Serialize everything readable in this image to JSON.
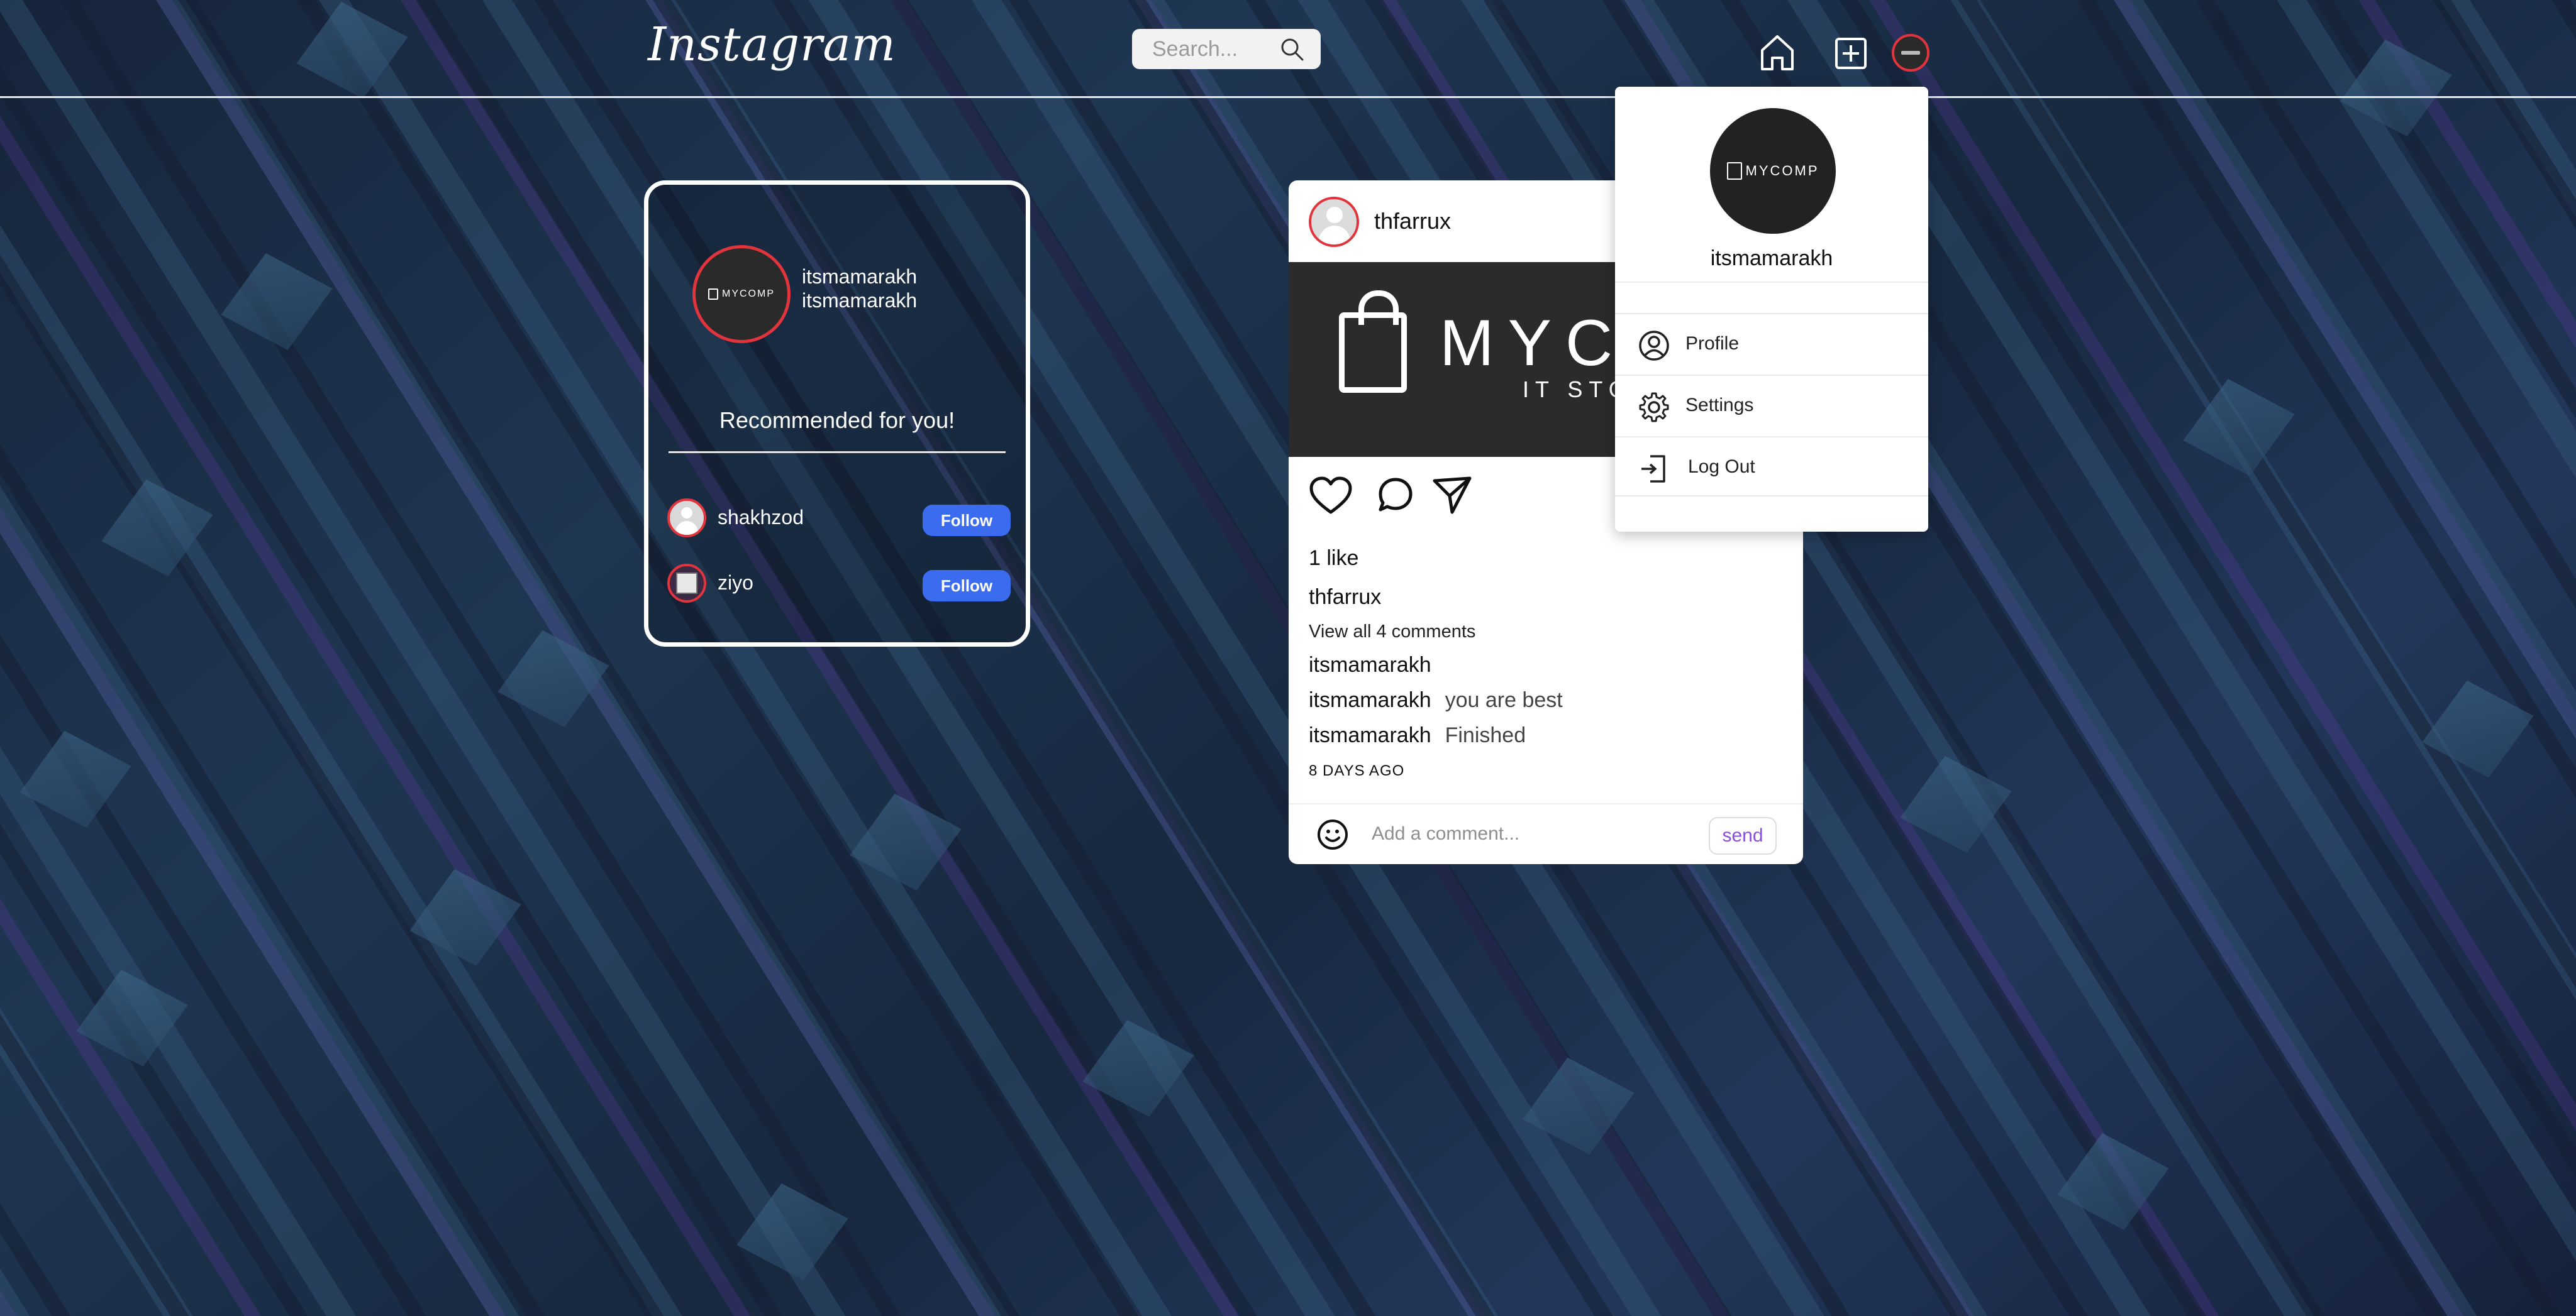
{
  "header": {
    "logo": "Instagram",
    "search_placeholder": "Search..."
  },
  "sidebar_card": {
    "username": "itsmamarakh",
    "display_name": "itsmamarakh",
    "recommended_title": "Recommended for you!",
    "suggestions": [
      {
        "username": "shakhzod",
        "button": "Follow"
      },
      {
        "username": "ziyo",
        "button": "Follow"
      }
    ]
  },
  "post": {
    "author": "thfarrux",
    "image_brand": "MYCOMP",
    "image_tagline": "IT STORE",
    "likes_text": "1 like",
    "caption_user": "thfarrux",
    "view_all_comments": "View all 4 comments",
    "comments": [
      {
        "user": "itsmamarakh",
        "text": ""
      },
      {
        "user": "itsmamarakh",
        "text": "you are best"
      },
      {
        "user": "itsmamarakh",
        "text": "Finished"
      }
    ],
    "time_ago": "8 DAYS AGO",
    "comment_placeholder": "Add a comment...",
    "send_label": "send"
  },
  "dropdown": {
    "avatar_brand": "MYCOMP",
    "username": "itsmamarakh",
    "items": [
      {
        "label": "Profile",
        "icon": "user-circle-icon"
      },
      {
        "label": "Settings",
        "icon": "gear-icon"
      },
      {
        "label": "Log Out",
        "icon": "logout-icon"
      }
    ]
  },
  "colors": {
    "accent_ring": "#e2343c",
    "follow_button": "#3b6cf0",
    "send_text": "#8a4fd8"
  }
}
